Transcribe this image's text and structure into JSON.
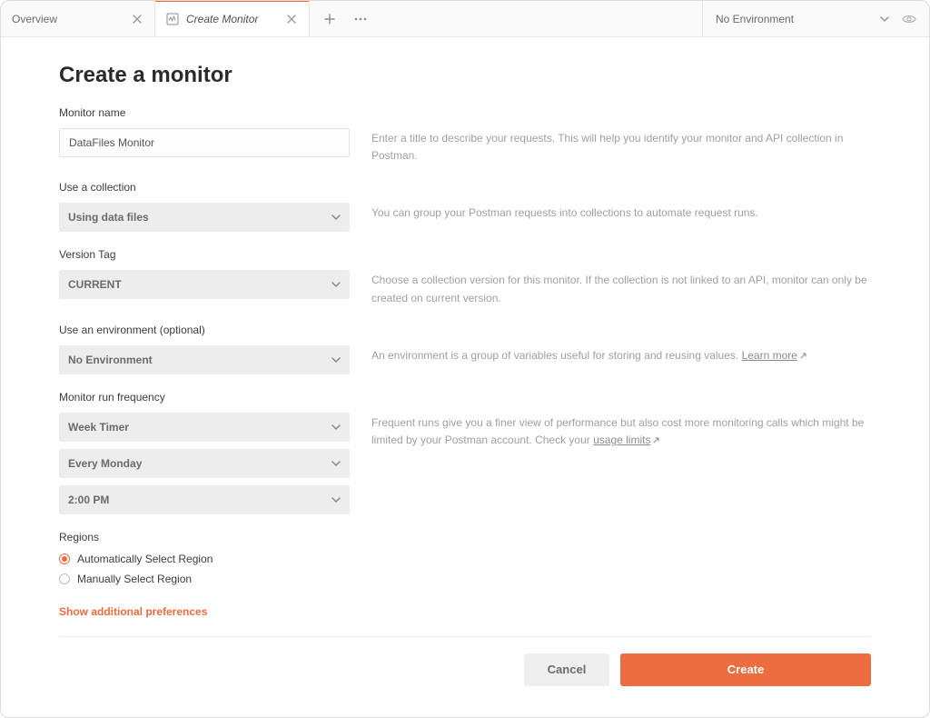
{
  "tabs": {
    "overview": "Overview",
    "create": "Create Monitor"
  },
  "env_selector": "No Environment",
  "page_title": "Create a monitor",
  "labels": {
    "monitor_name": "Monitor name",
    "use_collection": "Use a collection",
    "version_tag": "Version Tag",
    "use_environment": "Use an environment (optional)",
    "run_frequency": "Monitor run frequency",
    "regions": "Regions"
  },
  "values": {
    "monitor_name": "DataFiles Monitor",
    "collection": "Using data files",
    "version_tag": "CURRENT",
    "environment": "No Environment",
    "freq_timer": "Week Timer",
    "freq_day": "Every Monday",
    "freq_time": "2:00 PM"
  },
  "help": {
    "monitor_name": "Enter a title to describe your requests. This will help you identify your monitor and API collection in Postman.",
    "collection": "You can group your Postman requests into collections to automate request runs.",
    "version_tag": "Choose a collection version for this monitor. If the collection is not linked to an API, monitor can only be created on current version.",
    "environment_pre": "An environment is a group of variables useful for storing and reusing values. ",
    "environment_link": "Learn more",
    "frequency_pre": "Frequent runs give you a finer view of performance but also cost more monitoring calls which might be limited by your Postman account. Check your ",
    "frequency_link": "usage limits"
  },
  "regions": {
    "auto": "Automatically Select Region",
    "manual": "Manually Select Region"
  },
  "show_more": "Show additional preferences",
  "buttons": {
    "cancel": "Cancel",
    "create": "Create"
  }
}
